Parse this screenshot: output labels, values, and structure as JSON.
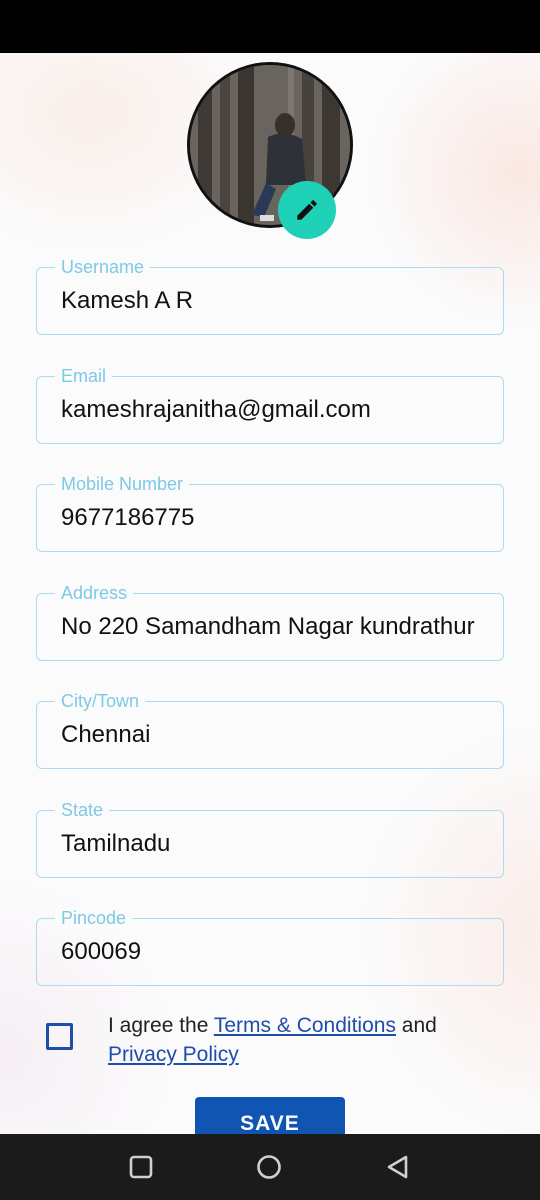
{
  "profile": {
    "avatar_alt": "profile-photo",
    "edit_icon": "pencil-icon",
    "edit_color": "#1fd1b7"
  },
  "form": {
    "fields": [
      {
        "label": "Username",
        "value": "Kamesh A R"
      },
      {
        "label": "Email",
        "value": "kameshrajanitha@gmail.com"
      },
      {
        "label": "Mobile Number",
        "value": "9677186775"
      },
      {
        "label": "Address",
        "value": "No 220 Samandham Nagar kundrathur"
      },
      {
        "label": "City/Town",
        "value": "Chennai"
      },
      {
        "label": "State",
        "value": "Tamilnadu"
      },
      {
        "label": "Pincode",
        "value": "600069"
      }
    ],
    "agreement": {
      "prefix": "I agree the ",
      "terms_link": "Terms & Conditions",
      "middle": " and",
      "privacy_link": "Privacy Policy",
      "checked": false
    },
    "save_label": "SAVE"
  },
  "nav": {
    "recent_icon": "square-icon",
    "home_icon": "circle-icon",
    "back_icon": "triangle-back-icon"
  },
  "colors": {
    "field_border": "#a8dcf0",
    "label": "#7ec9e6",
    "primary": "#1155b3",
    "link": "#1e4ea8"
  }
}
